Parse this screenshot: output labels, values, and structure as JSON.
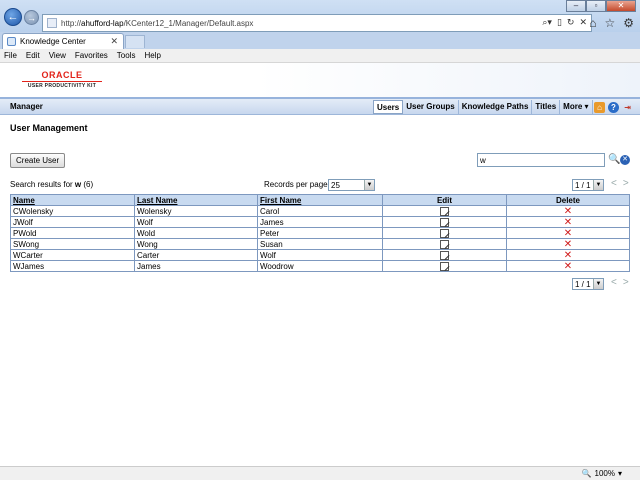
{
  "browser": {
    "url_prefix": "http://",
    "url_host": "ahufford-lap",
    "url_path": "/KCenter12_1/Manager/Default.aspx",
    "tab_title": "Knowledge Center",
    "menu": [
      "File",
      "Edit",
      "View",
      "Favorites",
      "Tools",
      "Help"
    ],
    "zoom": "100%"
  },
  "header": {
    "brand": "ORACLE",
    "product": "USER PRODUCTIVITY KIT",
    "app_name": "Manager",
    "nav": [
      "Users",
      "User Groups",
      "Knowledge Paths",
      "Titles",
      "More ▾"
    ]
  },
  "main": {
    "title": "User Management",
    "create_button": "Create User",
    "search_value": "w",
    "results_prefix": "Search results for ",
    "results_term": "w",
    "results_count": " (6)",
    "records_label": "Records per page:",
    "records_value": "25",
    "page_value": "1 / 1",
    "columns": [
      "Name",
      "Last Name",
      "First Name",
      "Edit",
      "Delete"
    ],
    "rows": [
      {
        "name": "CWolensky",
        "last": "Wolensky",
        "first": "Carol"
      },
      {
        "name": "JWolf",
        "last": "Wolf",
        "first": "James"
      },
      {
        "name": "PWold",
        "last": "Wold",
        "first": "Peter"
      },
      {
        "name": "SWong",
        "last": "Wong",
        "first": "Susan"
      },
      {
        "name": "WCarter",
        "last": "Carter",
        "first": "Wolf"
      },
      {
        "name": "WJames",
        "last": "James",
        "first": "Woodrow"
      }
    ]
  },
  "colors": {
    "accent": "#c8daf0",
    "brand_red": "#e2231a",
    "delete_red": "#d01a1a"
  }
}
